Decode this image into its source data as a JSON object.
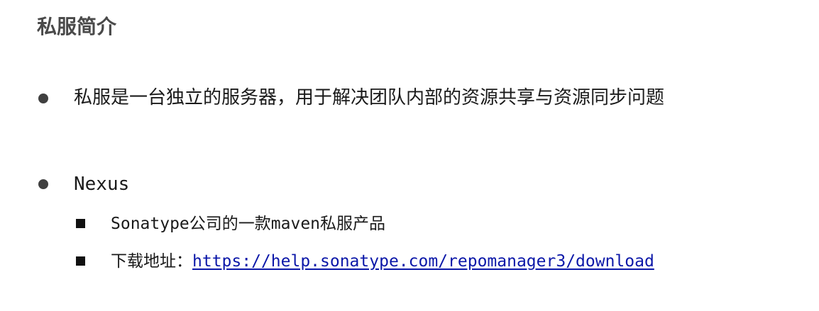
{
  "title": "私服简介",
  "bullets": [
    {
      "text": "私服是一台独立的服务器，用于解决团队内部的资源共享与资源同步问题"
    },
    {
      "text": "Nexus",
      "sub": [
        {
          "text": "Sonatype公司的一款maven私服产品"
        },
        {
          "label": "下载地址：",
          "link": "https://help.sonatype.com/repomanager3/download"
        }
      ]
    }
  ],
  "colors": {
    "title": "#4a4a4a",
    "text": "#1a1a1a",
    "link": "#0b17a8",
    "bullet": "#404040"
  }
}
